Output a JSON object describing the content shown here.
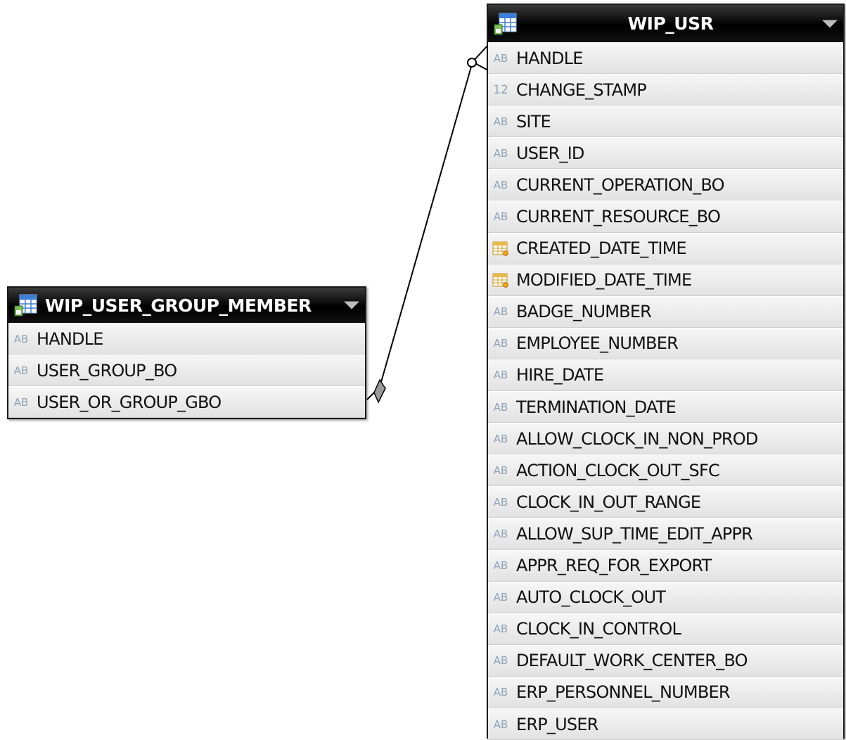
{
  "tables": {
    "member": {
      "title": "WIP_USER_GROUP_MEMBER",
      "columns": [
        {
          "type": "text",
          "type_label": "AB",
          "name": "HANDLE"
        },
        {
          "type": "text",
          "type_label": "AB",
          "name": "USER_GROUP_BO"
        },
        {
          "type": "text",
          "type_label": "AB",
          "name": "USER_OR_GROUP_GBO"
        }
      ]
    },
    "user": {
      "title": "WIP_USR",
      "columns": [
        {
          "type": "text",
          "type_label": "AB",
          "name": "HANDLE"
        },
        {
          "type": "number",
          "type_label": "12",
          "name": "CHANGE_STAMP"
        },
        {
          "type": "text",
          "type_label": "AB",
          "name": "SITE"
        },
        {
          "type": "text",
          "type_label": "AB",
          "name": "USER_ID"
        },
        {
          "type": "text",
          "type_label": "AB",
          "name": "CURRENT_OPERATION_BO"
        },
        {
          "type": "text",
          "type_label": "AB",
          "name": "CURRENT_RESOURCE_BO"
        },
        {
          "type": "datetime",
          "type_label": "",
          "name": "CREATED_DATE_TIME"
        },
        {
          "type": "datetime",
          "type_label": "",
          "name": "MODIFIED_DATE_TIME"
        },
        {
          "type": "text",
          "type_label": "AB",
          "name": "BADGE_NUMBER"
        },
        {
          "type": "text",
          "type_label": "AB",
          "name": "EMPLOYEE_NUMBER"
        },
        {
          "type": "text",
          "type_label": "AB",
          "name": "HIRE_DATE"
        },
        {
          "type": "text",
          "type_label": "AB",
          "name": "TERMINATION_DATE"
        },
        {
          "type": "text",
          "type_label": "AB",
          "name": "ALLOW_CLOCK_IN_NON_PROD"
        },
        {
          "type": "text",
          "type_label": "AB",
          "name": "ACTION_CLOCK_OUT_SFC"
        },
        {
          "type": "text",
          "type_label": "AB",
          "name": "CLOCK_IN_OUT_RANGE"
        },
        {
          "type": "text",
          "type_label": "AB",
          "name": "ALLOW_SUP_TIME_EDIT_APPR"
        },
        {
          "type": "text",
          "type_label": "AB",
          "name": "APPR_REQ_FOR_EXPORT"
        },
        {
          "type": "text",
          "type_label": "AB",
          "name": "AUTO_CLOCK_OUT"
        },
        {
          "type": "text",
          "type_label": "AB",
          "name": "CLOCK_IN_CONTROL"
        },
        {
          "type": "text",
          "type_label": "AB",
          "name": "DEFAULT_WORK_CENTER_BO"
        },
        {
          "type": "text",
          "type_label": "AB",
          "name": "ERP_PERSONNEL_NUMBER"
        },
        {
          "type": "text",
          "type_label": "AB",
          "name": "ERP_USER"
        }
      ]
    }
  },
  "relationship": {
    "from_table": "WIP_USER_GROUP_MEMBER",
    "from_column": "USER_OR_GROUP_GBO",
    "to_table": "WIP_USR",
    "to_column": "HANDLE"
  },
  "colors": {
    "header_background": "#000000",
    "header_text": "#ffffff",
    "row_background": "#ececec",
    "type_label": "#8ea3b8",
    "connector": "#000000"
  }
}
